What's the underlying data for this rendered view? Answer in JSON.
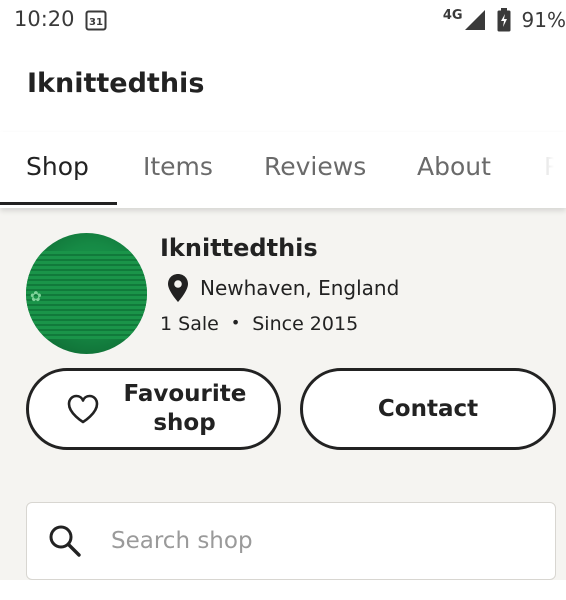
{
  "status_bar": {
    "time": "10:20",
    "calendar_date": "31",
    "network": "4G",
    "battery": "91%"
  },
  "header": {
    "title": "Iknittedthis"
  },
  "tabs": [
    {
      "label": "Shop",
      "active": true
    },
    {
      "label": "Items",
      "active": false
    },
    {
      "label": "Reviews",
      "active": false
    },
    {
      "label": "About",
      "active": false
    },
    {
      "label": "Po",
      "active": false
    }
  ],
  "shop": {
    "name": "Iknittedthis",
    "location": "Newhaven, England",
    "sales": "1 Sale",
    "separator": "•",
    "since": "Since 2015"
  },
  "actions": {
    "favourite_label": "Favourite shop",
    "contact_label": "Contact"
  },
  "search": {
    "placeholder": "Search shop",
    "value": ""
  },
  "colors": {
    "text": "#222222",
    "tab_inactive": "#6a6a6a",
    "content_bg": "#f5f4f1",
    "avatar_green": "#168a45"
  },
  "icons": [
    "calendar-icon",
    "signal-icon",
    "battery-icon",
    "location-pin-icon",
    "heart-icon",
    "search-icon"
  ]
}
